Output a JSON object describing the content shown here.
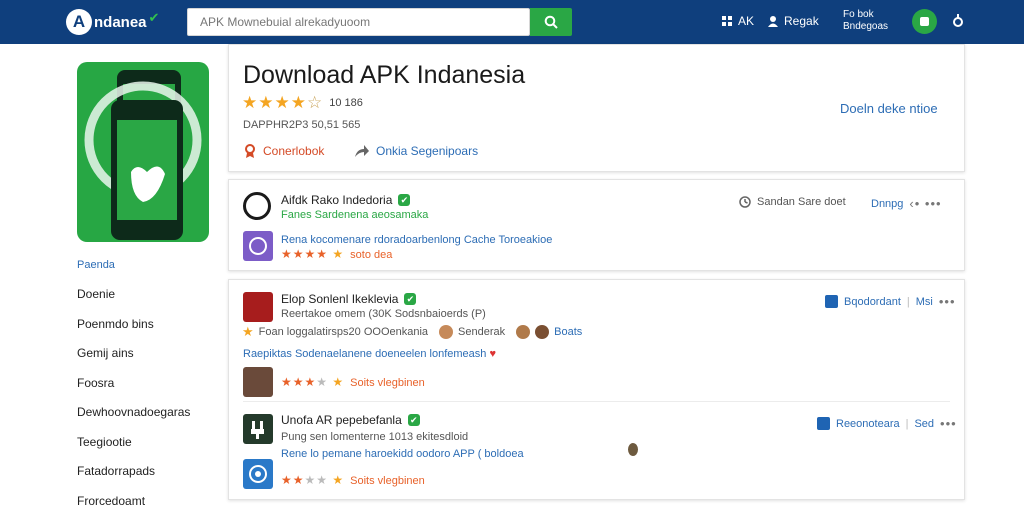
{
  "header": {
    "logo_mark": "A",
    "logo_text": "ndanea",
    "search_placeholder": "APK Mownebuial alrekadyuoom",
    "links": [
      {
        "label": "AK"
      },
      {
        "label": "Regak"
      }
    ],
    "user_line1": "Fo bok",
    "user_line2": "Bndegoas"
  },
  "sidebar": {
    "items": [
      "Paenda",
      "Doenie",
      "Poenmdo bins",
      "Gemij ains",
      "Foosra",
      "Dewhoovnadoegaras",
      "Teegiootie",
      "Fatadorrapads",
      "Frorcedoamt"
    ]
  },
  "app": {
    "title": "Download APK Indanesia",
    "rating_count": "10 186",
    "meta": "DAPPHR2P3 50,51 565",
    "action_left": "Conerlobok",
    "action_right": "Onkia Segenipoars",
    "download_link": "Doeln deke ntioe"
  },
  "reviews": [
    {
      "name": "Aifdk Rako Indedoria",
      "sub": "Fanes Sardenena aeosamaka",
      "text": "Rena kocomenare rdoradoarbenlong Cache Toroeakioe",
      "stars_label": "soto dea",
      "right_text": "Sandan Sare doet",
      "right_link": "Dnnpg"
    },
    {
      "name": "Elop Sonlenl Ikeklevia",
      "sub": "Reertakoe omem (30K Sodsnbaioerds (P)",
      "line2_text": "Foan loggalatirsps20 OOOenkania",
      "line2_a": "Senderak",
      "line2_b": "Boats",
      "text": "Raepiktas Sodenaelanene doeneelen lonfemeash",
      "stars_label": "Soits vlegbinen",
      "right_link": "Bqodordant",
      "right_extra": "Msi"
    },
    {
      "name": "Unofa AR pepebefanla",
      "sub": "Pung sen lomenterne 1013 ekitesdloid",
      "text": "Rene lo pemane haroekidd oodoro APP ( boldoea",
      "stars_label": "Soits vlegbinen",
      "right_link": "Reeonoteara",
      "right_extra": "Sed"
    }
  ]
}
